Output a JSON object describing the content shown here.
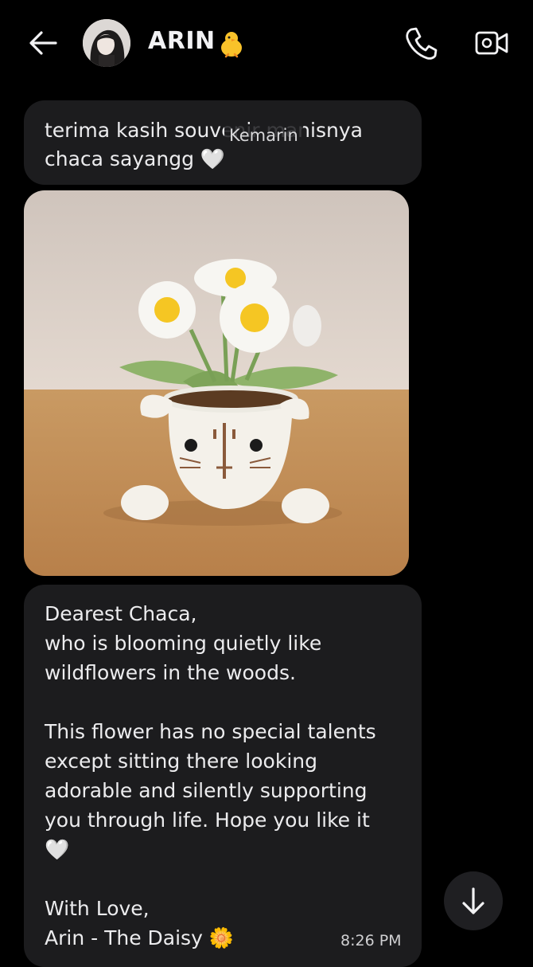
{
  "header": {
    "contact_name": "ARIN",
    "name_emoji": "chick-icon",
    "icons": [
      "back-arrow-icon",
      "phone-icon",
      "video-camera-icon"
    ]
  },
  "messages": [
    {
      "text": "terima kasih souvenir manisnya\nchaca sayangg 🤍"
    },
    {
      "type": "image",
      "description_icon": "crochet-flower-pot-image"
    },
    {
      "text": "Dearest Chaca,\nwho is blooming quietly like\nwildflowers in the woods.\n\nThis flower has no special talents\nexcept sitting there looking\nadorable and silently supporting\nyou through life. Hope you like it\n🤍\n\nWith Love,\nArin - The Daisy 🌼",
      "time": "8:26 PM"
    }
  ],
  "day_separator": "Kemarin",
  "colors": {
    "background": "#000000",
    "bubble": "#1c1c1e",
    "text": "#ececee",
    "scroll_button": "#1f1f22"
  }
}
